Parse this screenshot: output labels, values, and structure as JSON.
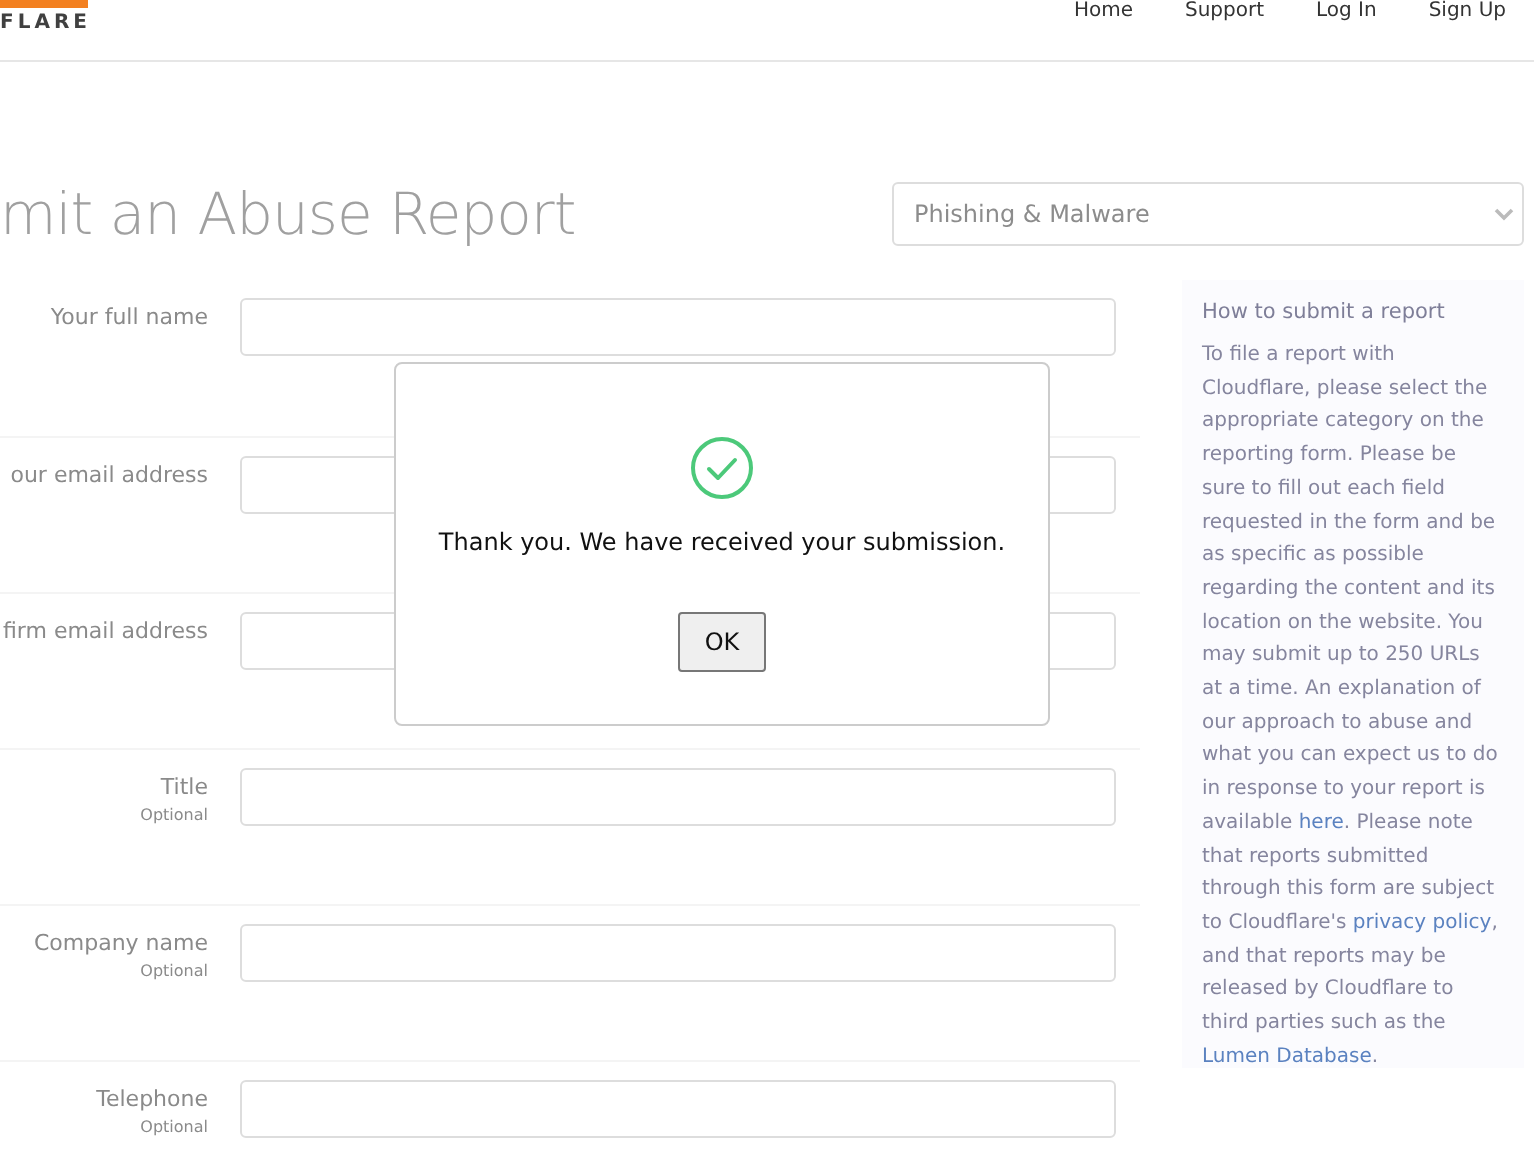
{
  "header": {
    "logo_text": "FLARE",
    "nav": [
      "Home",
      "Support",
      "Log In",
      "Sign Up"
    ]
  },
  "page_title": "mit an Abuse Report",
  "category_select": {
    "value": "Phishing & Malware"
  },
  "form_fields": [
    {
      "label": "Your full name"
    },
    {
      "label": "our email address"
    },
    {
      "label": "firm email address"
    },
    {
      "label": "Title",
      "hint": "Optional"
    },
    {
      "label": "Company name",
      "hint": "Optional"
    },
    {
      "label": "Telephone",
      "hint": "Optional"
    }
  ],
  "help_panel": {
    "title": "How to submit a report",
    "body": [
      {
        "kind": "text",
        "text": "To file a report with Cloudflare, please select the appropriate category on the reporting form. Please be sure to fill out each field requested in the form and be as specific as possible regarding the content and its location on the website. You may submit up to 250 URLs at a time. An explanation of our approach to abuse and what you can expect us to do in response to your report is available "
      },
      {
        "kind": "link",
        "text": "here"
      },
      {
        "kind": "text",
        "text": ". Please note that reports submitted through this form are subject to Cloudflare's "
      },
      {
        "kind": "link",
        "text": "privacy policy"
      },
      {
        "kind": "text",
        "text": ", and that reports may be released by Cloudflare to third parties such as the "
      },
      {
        "kind": "link",
        "text": "Lumen Database"
      },
      {
        "kind": "text",
        "text": "."
      }
    ]
  },
  "dialog": {
    "message": "Thank you. We have received your submission.",
    "button": "OK"
  }
}
